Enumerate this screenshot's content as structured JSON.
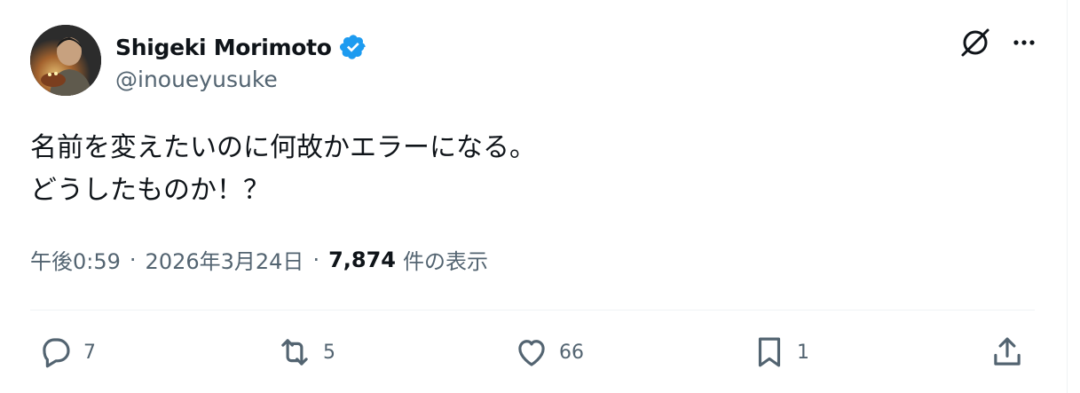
{
  "author": {
    "name": "Shigeki Morimoto",
    "handle": "@inoueyusuke",
    "verified": true
  },
  "tweet": {
    "lines": [
      "名前を変えたいのに何故かエラーになる。",
      "どうしたものか！？"
    ]
  },
  "meta": {
    "time": "午後0:59",
    "separator": "·",
    "date": "2026年3月24日",
    "views_count": "7,874",
    "views_label": "件の表示"
  },
  "actions": {
    "reply_count": "7",
    "retweet_count": "5",
    "like_count": "66",
    "bookmark_count": "1"
  },
  "colors": {
    "text": "#0f1419",
    "secondary": "#536471",
    "verified": "#1d9bf0",
    "divider": "#eff3f4"
  },
  "icons": [
    "verified-badge-icon",
    "grok-icon",
    "more-icon",
    "reply-icon",
    "retweet-icon",
    "like-icon",
    "bookmark-icon",
    "share-icon"
  ]
}
